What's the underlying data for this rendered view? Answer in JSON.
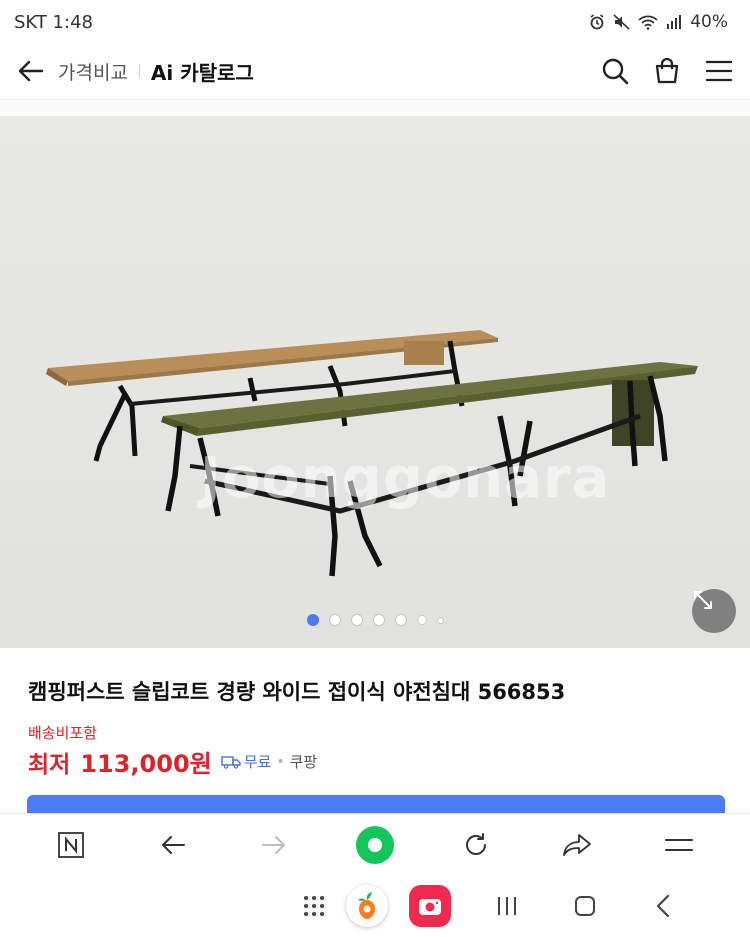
{
  "status_bar": {
    "carrier_time": "SKT 1:48",
    "battery": "40%"
  },
  "header": {
    "crumb_primary": "가격비교",
    "crumb_secondary": "Ai 카탈로그"
  },
  "gallery": {
    "watermark": "Joonggonara",
    "slide_count": 7,
    "active_slide": 1
  },
  "product": {
    "title": "캠핑퍼스트 슬립코트 경량 와이드 접이식 야전침대 566853",
    "shipping_note": "배송비포함",
    "price_label": "최저",
    "price": "113,000원",
    "shipping_badge": "무료",
    "seller": "쿠팡"
  },
  "colors": {
    "accent": "#4b7cf5",
    "price": "#e0222e",
    "home": "#14c55a",
    "app_icon": "#f0294f"
  }
}
